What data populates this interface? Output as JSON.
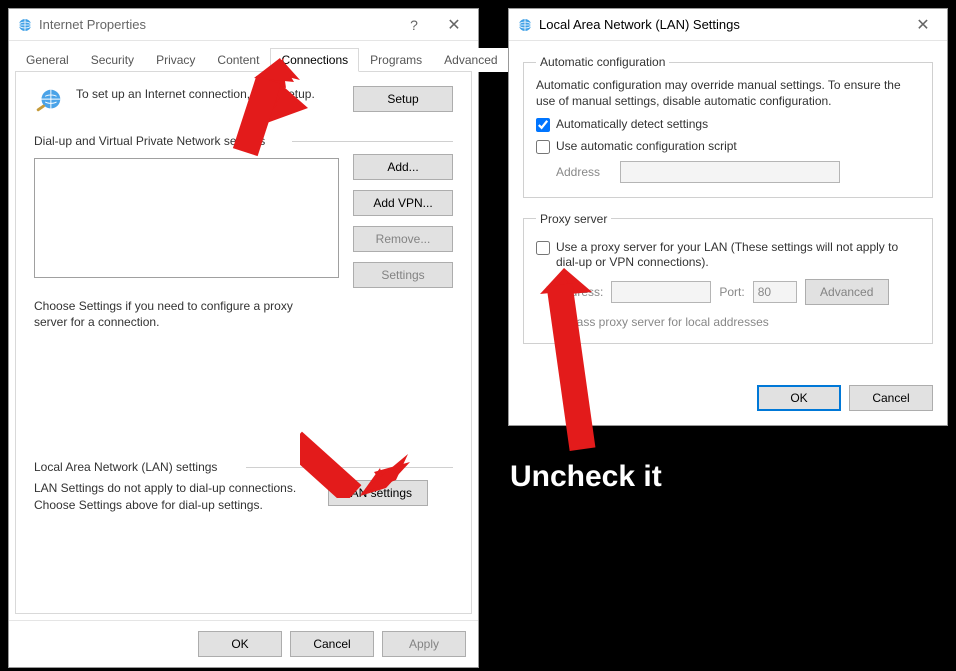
{
  "ip": {
    "title": "Internet Properties",
    "tabs": [
      "General",
      "Security",
      "Privacy",
      "Content",
      "Connections",
      "Programs",
      "Advanced"
    ],
    "active_tab": "Connections",
    "setup_text": "To set up an Internet connection, click Setup.",
    "setup_btn": "Setup",
    "dialup_legend": "Dial-up and Virtual Private Network settings",
    "add_btn": "Add...",
    "add_vpn_btn": "Add VPN...",
    "remove_btn": "Remove...",
    "settings_btn": "Settings",
    "choose_note": "Choose Settings if you need to configure a proxy server for a connection.",
    "lan_legend": "Local Area Network (LAN) settings",
    "lan_note": "LAN Settings do not apply to dial-up connections. Choose Settings above for dial-up settings.",
    "lan_btn": "LAN settings",
    "ok": "OK",
    "cancel": "Cancel",
    "apply": "Apply"
  },
  "lan": {
    "title": "Local Area Network (LAN) Settings",
    "auto_legend": "Automatic configuration",
    "auto_desc": "Automatic configuration may override manual settings.  To ensure the use of manual settings, disable automatic configuration.",
    "auto_detect": "Automatically detect settings",
    "auto_detect_checked": true,
    "use_script": "Use automatic configuration script",
    "use_script_checked": false,
    "addr_label": "Address",
    "addr_value": "",
    "proxy_legend": "Proxy server",
    "use_proxy": "Use a proxy server for your LAN (These settings will not apply to dial-up or VPN connections).",
    "use_proxy_checked": false,
    "proxy_addr_label": "Address:",
    "proxy_addr_value": "",
    "port_label": "Port:",
    "port_value": "80",
    "advanced_btn": "Advanced",
    "bypass": "Bypass proxy server for local addresses",
    "ok": "OK",
    "cancel": "Cancel"
  },
  "annotation": {
    "uncheck": "Uncheck it"
  }
}
